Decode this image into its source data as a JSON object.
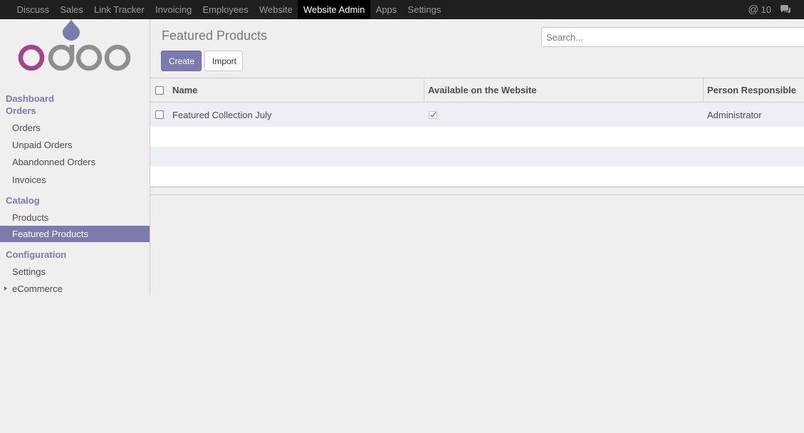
{
  "topbar": {
    "menu": [
      "Discuss",
      "Sales",
      "Link Tracker",
      "Invoicing",
      "Employees",
      "Website",
      "Website Admin",
      "Apps",
      "Settings"
    ],
    "active_menu": "Website Admin",
    "notification_count": "10"
  },
  "sidebar": {
    "dashboard": "Dashboard",
    "orders_header": "Orders",
    "orders": "Orders",
    "unpaid_orders": "Unpaid Orders",
    "abandoned_orders": "Abandonned Orders",
    "invoices": "Invoices",
    "catalog_header": "Catalog",
    "products": "Products",
    "featured_products": "Featured Products",
    "configuration_header": "Configuration",
    "settings": "Settings",
    "ecommerce": "eCommerce"
  },
  "control_panel": {
    "title": "Featured Products",
    "search_placeholder": "Search...",
    "create_label": "Create",
    "import_label": "Import"
  },
  "list": {
    "columns": [
      "Name",
      "Available on the Website",
      "Person Responsible"
    ],
    "rows": [
      {
        "name": "Featured Collection July",
        "available": true,
        "person": "Administrator"
      }
    ]
  },
  "colors": {
    "accent": "#7c7bad",
    "navbar": "#1f1f1f",
    "logo_pink": "#a24689",
    "logo_gray": "#8f8f8f"
  }
}
